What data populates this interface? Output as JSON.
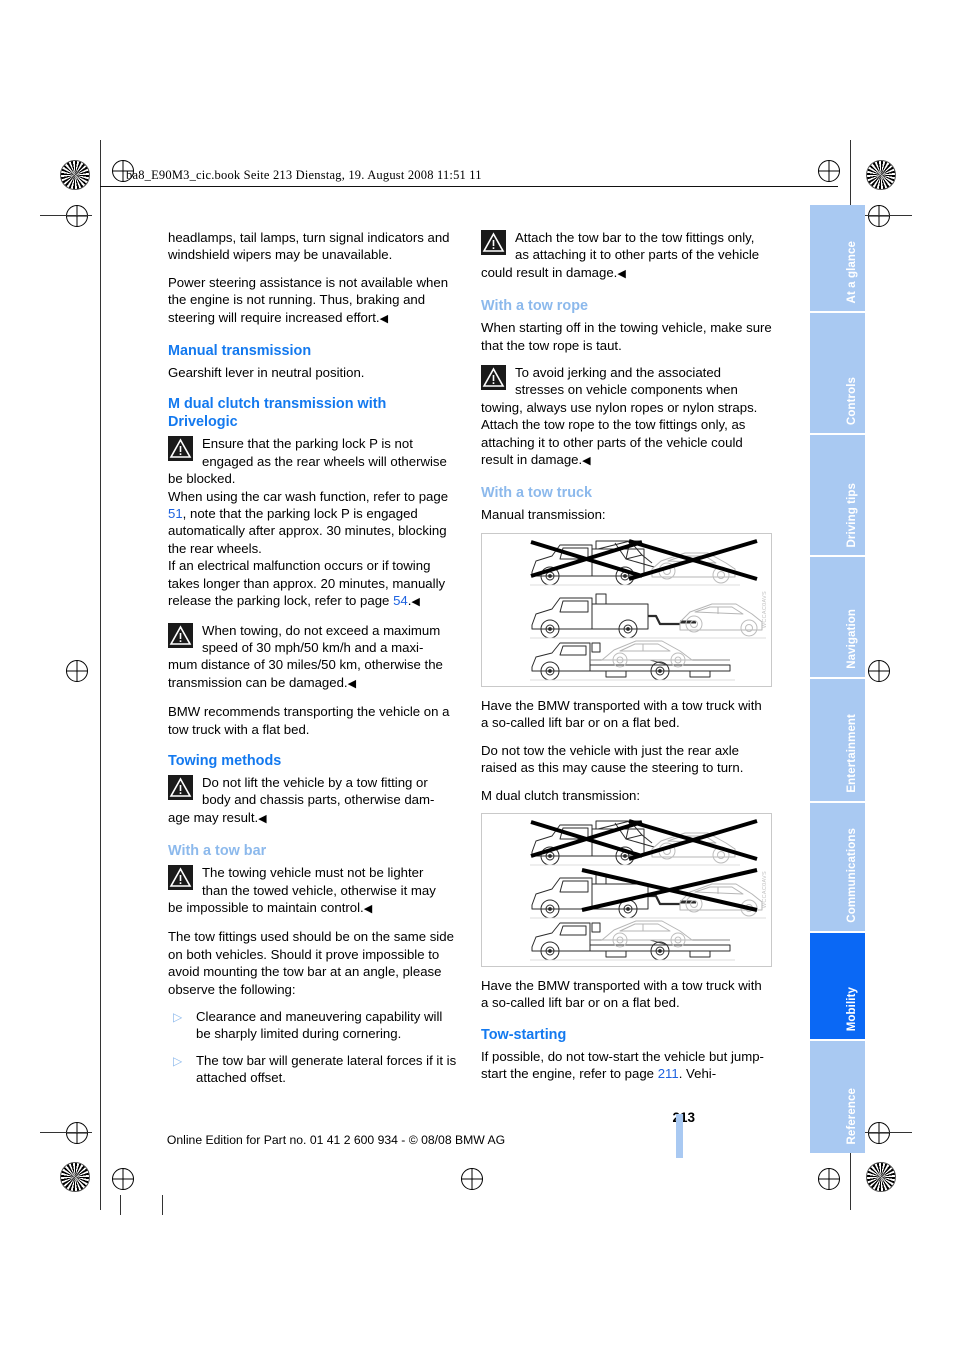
{
  "header": {
    "file_line": "ba8_E90M3_cic.book  Seite 213  Dienstag, 19. August 2008  11:51 11"
  },
  "left_column": {
    "para_1": "headlamps, tail lamps, turn signal indicators and windshield wipers may be unavailable.",
    "para_2": "Power steering assistance is not available when the engine is not running. Thus, braking and steering will require increased effort.",
    "heading_manual": "Manual transmission",
    "para_3": "Gearshift lever in neutral position.",
    "heading_mdct": "M dual clutch transmission with Drivelogic",
    "warn_1_line1": "Ensure that the parking lock P is not",
    "warn_1_line2": "engaged as the rear wheels will otherwise",
    "warn_1_rest": "be blocked.",
    "warn_1_p2_a": "When using the car wash function, refer to page ",
    "warn_1_p2_ref": "51",
    "warn_1_p2_b": ", note that the parking lock P is engaged automatically after approx. 30 minutes, blocking the rear wheels.",
    "warn_1_p3_a": "If an electrical malfunction occurs or if towing takes longer than approx. 20 minutes, manually release the parking lock, refer to page ",
    "warn_1_p3_ref": "54",
    "warn_1_p3_b": ".",
    "warn_2_line1": "When towing, do not exceed a maximum",
    "warn_2_line2": "speed of 30 mph/50 km/h and a maxi-",
    "warn_2_rest": "mum distance of 30 miles/50 km, otherwise the transmission can be damaged.",
    "para_4": "BMW recommends transporting the vehicle on a tow truck with a flat bed.",
    "heading_towing_methods": "Towing methods",
    "warn_3_line1": "Do not lift the vehicle by a tow fitting or",
    "warn_3_line2": "body and chassis parts, otherwise dam-",
    "warn_3_rest": "age may result.",
    "heading_tow_bar": "With a tow bar",
    "warn_4_line1": "The towing vehicle must not be lighter",
    "warn_4_line2": "than the towed vehicle, otherwise it may",
    "warn_4_rest": "be impossible to maintain control.",
    "para_5": "The tow fittings used should be on the same side on both vehicles. Should it prove impossible to avoid mounting the tow bar at an angle, please observe the following:",
    "bullet_1": "Clearance and maneuvering capability will be sharply limited during cornering.",
    "bullet_2": "The tow bar will generate lateral forces if it is attached offset."
  },
  "right_column": {
    "warn_5_line1": "Attach the tow bar to the tow fittings only,",
    "warn_5_line2": "as attaching it to other parts of the vehicle",
    "warn_5_rest": "could result in damage.",
    "heading_tow_rope": "With a tow rope",
    "para_1": "When starting off in the towing vehicle, make sure that the tow rope is taut.",
    "warn_6_line1": "To avoid jerking and the associated",
    "warn_6_line2": "stresses on vehicle components when",
    "warn_6_rest": "towing, always use nylon ropes or nylon straps. Attach the tow rope to the tow fittings only, as attaching it to other parts of the vehicle could result in damage.",
    "heading_tow_truck": "With a tow truck",
    "caption_manual": "Manual transmission:",
    "figure_1_code": "WCCAC0AVS",
    "para_2": "Have the BMW transported with a tow truck with a so-called lift bar or on a flat bed.",
    "para_3": "Do not tow the vehicle with just the rear axle raised as this may cause the steering to turn.",
    "caption_mdct": "M dual clutch transmission:",
    "figure_2_code": "WCCAC0AVS",
    "para_4": "Have the BMW transported with a tow truck with a so-called lift bar or on a flat bed.",
    "heading_tow_starting": "Tow-starting",
    "para_5_a": "If possible, do not tow-start the vehicle but jump-start the engine, refer to page ",
    "para_5_ref": "211",
    "para_5_b": ". Vehi-"
  },
  "sidebar": {
    "tabs": [
      {
        "label": "At a glance",
        "active": false
      },
      {
        "label": "Controls",
        "active": false
      },
      {
        "label": "Driving tips",
        "active": false
      },
      {
        "label": "Navigation",
        "active": false
      },
      {
        "label": "Entertainment",
        "active": false
      },
      {
        "label": "Communications",
        "active": false
      },
      {
        "label": "Mobility",
        "active": true
      },
      {
        "label": "Reference",
        "active": false
      }
    ]
  },
  "footer": {
    "page_number": "213",
    "imprint": "Online Edition for Part no. 01 41 2 600 934 - © 08/08 BMW AG"
  },
  "colors": {
    "heading_primary": "#1379ef",
    "heading_secondary": "#8cb9ec",
    "link": "#1e63e0",
    "tab_inactive": "#a9c9f2",
    "tab_active": "#0a68f5"
  },
  "end_mark": "◀"
}
